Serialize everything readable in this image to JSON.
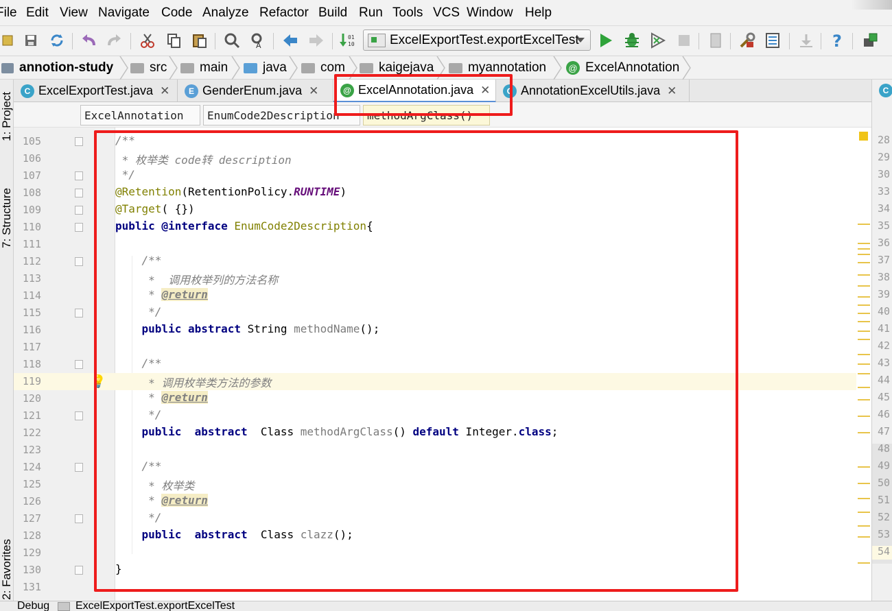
{
  "menu": [
    {
      "label": "File"
    },
    {
      "label": "Edit"
    },
    {
      "label": "View"
    },
    {
      "label": "Navigate"
    },
    {
      "label": "Code"
    },
    {
      "label": "Analyze"
    },
    {
      "label": "Refactor"
    },
    {
      "label": "Build"
    },
    {
      "label": "Run"
    },
    {
      "label": "Tools"
    },
    {
      "label": "VCS"
    },
    {
      "label": "Window"
    },
    {
      "label": "Help"
    }
  ],
  "toolbar": {
    "run_config": "ExcelExportTest.exportExcelTest"
  },
  "breadcrumb": [
    "annotion-study",
    "src",
    "main",
    "java",
    "com",
    "kaigejava",
    "myannotation",
    "ExcelAnnotation"
  ],
  "tabs": [
    {
      "label": "ExcelExportTest.java",
      "icon": "C",
      "close": "✕"
    },
    {
      "label": "GenderEnum.java",
      "icon": "E",
      "close": "✕"
    },
    {
      "label": "ExcelAnnotation.java",
      "icon": "@",
      "close": "✕"
    },
    {
      "label": "AnnotationExcelUtils.java",
      "icon": "C",
      "close": "✕"
    }
  ],
  "structure_bar": [
    "ExcelAnnotation",
    "EnumCode2Description",
    "methodArgClass()"
  ],
  "side_tabs": {
    "project": "1: Project",
    "structure": "7: Structure",
    "favorites": "2: Favorites"
  },
  "code_lines": [
    {
      "n": "105"
    },
    {
      "n": "106"
    },
    {
      "n": "107"
    },
    {
      "n": "108"
    },
    {
      "n": "109"
    },
    {
      "n": "110"
    },
    {
      "n": "111"
    },
    {
      "n": "112"
    },
    {
      "n": "113"
    },
    {
      "n": "114"
    },
    {
      "n": "115"
    },
    {
      "n": "116"
    },
    {
      "n": "117"
    },
    {
      "n": "118"
    },
    {
      "n": "119"
    },
    {
      "n": "120"
    },
    {
      "n": "121"
    },
    {
      "n": "122"
    },
    {
      "n": "123"
    },
    {
      "n": "124"
    },
    {
      "n": "125"
    },
    {
      "n": "126"
    },
    {
      "n": "127"
    },
    {
      "n": "128"
    },
    {
      "n": "129"
    },
    {
      "n": "130"
    },
    {
      "n": "131"
    }
  ],
  "code_text": {
    "l105": "/**",
    "l106": " * 枚举类 code转 description",
    "l107": " */",
    "l108_ann": "@Retention",
    "l108_a": "(RetentionPolicy.",
    "l108_const": "RUNTIME",
    "l108_b": ")",
    "l109_ann": "@Target",
    "l109_rest": "( {})",
    "l110_kw": "public @interface",
    "l110_name": " EnumCode2Description",
    "l110_brace": "{",
    "l112": "    /**",
    "l113": "     *  调用枚举列的方法名称",
    "l114_pre": "     * ",
    "l114_tag": "@return",
    "l115": "     */",
    "l116_kw": "    public abstract",
    "l116_type": " String ",
    "l116_name": "methodName",
    "l116_end": "();",
    "l118": "    /**",
    "l119": "     * 调用枚举类方法的参数",
    "l120_pre": "     * ",
    "l120_tag": "@return",
    "l121": "     */",
    "l122_kw1": "    public  abstract",
    "l122_type": "  Class ",
    "l122_name": "methodArgClass",
    "l122_paren": "() ",
    "l122_kw2": "default",
    "l122_int": " Integer.",
    "l122_kw3": "class",
    "l122_end": ";",
    "l124": "    /**",
    "l125": "     * 枚举类",
    "l126_pre": "     * ",
    "l126_tag": "@return",
    "l127": "     */",
    "l128_kw": "    public  abstract",
    "l128_type": "  Class ",
    "l128_name": "clazz",
    "l128_end": "();",
    "l130": "}"
  },
  "right_pane_lines": [
    "28",
    "29",
    "30",
    "33",
    "34",
    "35",
    "36",
    "37",
    "38",
    "39",
    "40",
    "41",
    "42",
    "43",
    "44",
    "45",
    "46",
    "47",
    "48",
    "49",
    "50",
    "51",
    "52",
    "53",
    "54"
  ],
  "statusbar": {
    "debug": "Debug",
    "config": "ExcelExportTest.exportExcelTest"
  },
  "colors": {
    "annotation_red": "#ee1c1c",
    "keyword": "#000080",
    "annotation": "#808000",
    "comment": "#808080",
    "constant": "#660e7a"
  }
}
